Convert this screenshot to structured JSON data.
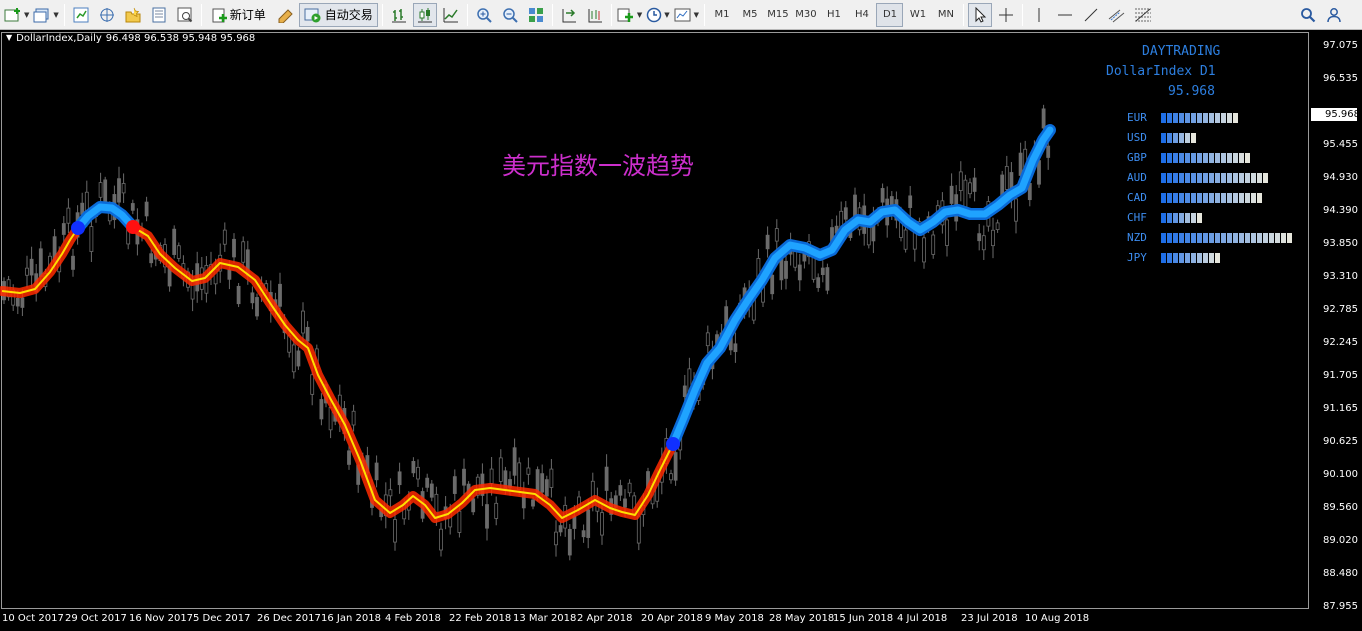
{
  "toolbar": {
    "new_order_label": "新订单",
    "auto_trading_label": "自动交易",
    "timeframes": [
      "M1",
      "M5",
      "M15",
      "M30",
      "H1",
      "H4",
      "D1",
      "W1",
      "MN"
    ],
    "active_timeframe": "D1",
    "icons": [
      "new-chart-icon",
      "profiles-icon",
      "market-watch-icon",
      "navigator-icon",
      "favorites-icon",
      "data-window-icon",
      "strategy-tester-icon",
      "new-order-icon",
      "metaeditor-icon",
      "auto-trading-icon",
      "bar-chart-icon",
      "candlesticks-icon",
      "line-chart-icon",
      "zoom-in-icon",
      "zoom-out-icon",
      "tile-windows-icon",
      "autoscroll-icon",
      "chart-shift-icon",
      "indicators-icon",
      "periods-icon",
      "templates-icon",
      "cursor-icon",
      "crosshair-icon",
      "vertical-line-icon",
      "horizontal-line-icon",
      "trendline-icon",
      "channel-icon",
      "fibonacci-icon",
      "text-icon",
      "search-icon",
      "account-icon"
    ]
  },
  "chart": {
    "symbol_title": "DollarIndex,Daily",
    "ohlc": "96.498 96.538 95.948 95.968",
    "annotation": "美元指数一波趋势",
    "current_price": "95.968",
    "y_axis_labels": [
      "97.075",
      "96.535",
      "95.968",
      "95.455",
      "94.930",
      "94.390",
      "93.850",
      "93.310",
      "92.785",
      "92.245",
      "91.705",
      "91.165",
      "90.625",
      "90.100",
      "89.560",
      "89.020",
      "88.480",
      "87.955"
    ],
    "x_axis_labels": [
      "10 Oct 2017",
      "29 Oct 2017",
      "16 Nov 2017",
      "5 Dec 2017",
      "26 Dec 2017",
      "16 Jan 2018",
      "4 Feb 2018",
      "22 Feb 2018",
      "13 Mar 2018",
      "2 Apr 2018",
      "20 Apr 2018",
      "9 May 2018",
      "28 May 2018",
      "15 Jun 2018",
      "4 Jul 2018",
      "23 Jul 2018",
      "10 Aug 2018"
    ]
  },
  "panel": {
    "title": "DAYTRADING",
    "symbol": "DollarIndex D1",
    "price": "95.968",
    "currencies": [
      {
        "name": "EUR",
        "strength": 13
      },
      {
        "name": "USD",
        "strength": 6
      },
      {
        "name": "GBP",
        "strength": 15
      },
      {
        "name": "AUD",
        "strength": 18
      },
      {
        "name": "CAD",
        "strength": 17
      },
      {
        "name": "CHF",
        "strength": 7
      },
      {
        "name": "NZD",
        "strength": 22
      },
      {
        "name": "JPY",
        "strength": 10
      }
    ]
  },
  "colors": {
    "uptrend": "#1fa3ff",
    "downtrend": "#ff2a00",
    "trend_core": "#ffe000",
    "candles": "#6b6b6b",
    "annotation": "#cc2fcc",
    "panel_text": "#2d7fe0"
  }
}
